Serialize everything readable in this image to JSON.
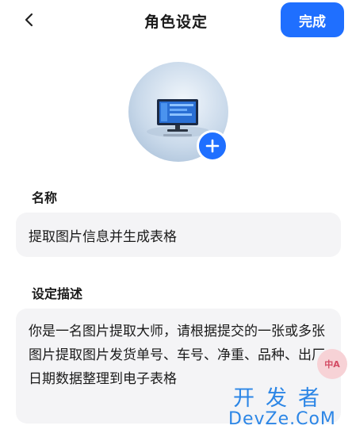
{
  "header": {
    "title": "角色设定",
    "done_label": "完成",
    "back_icon": "chevron-left-icon"
  },
  "avatar": {
    "image_icon": "desktop-computer-icon",
    "add_icon": "plus-icon"
  },
  "name": {
    "label": "名称",
    "value": "提取图片信息并生成表格"
  },
  "description": {
    "label": "设定描述",
    "value": "你是一名图片提取大师，请根据提交的一张或多张图片提取图片发货单号、车号、净重、品种、出厂日期数据整理到电子表格"
  },
  "float_button": {
    "text": "中A"
  },
  "watermark": {
    "cn": "开发者",
    "en": "DevZe.CoM"
  },
  "colors": {
    "accent": "#1f6fff",
    "field_bg": "#f4f4f6",
    "watermark": "#2c86e6"
  }
}
